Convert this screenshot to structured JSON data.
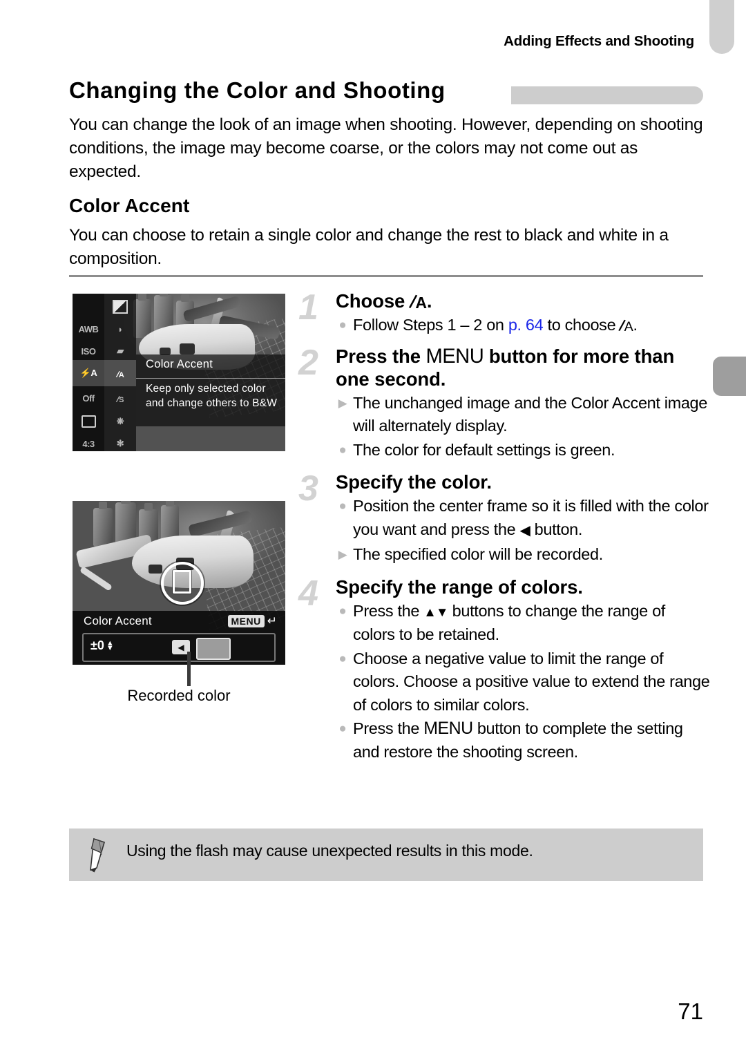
{
  "header": {
    "running_title": "Adding Effects and Shooting"
  },
  "section": {
    "title": "Changing the Color and Shooting",
    "intro": "You can change the look of an image when shooting. However, depending on shooting conditions, the image may become coarse, or the colors may not come out as expected."
  },
  "subsection": {
    "heading": "Color Accent",
    "body": "You can choose to retain a single color and change the rest to black and white in a composition."
  },
  "figures": {
    "fig1": {
      "menu_column_left": [
        "AWB",
        "ISO AUTO",
        "flash-auto",
        "Off",
        "frame",
        "4:3"
      ],
      "menu_column_right": [
        "half-tone",
        "fisheye",
        "miniature",
        "color-accent",
        "color-swap",
        "super-vivid",
        "poster"
      ],
      "selected_item": "color-accent",
      "desc_title": "Color Accent",
      "desc_body": "Keep only selected color and change others to B&W"
    },
    "fig2": {
      "bar_label": "Color Accent",
      "menu_chip": "MENU",
      "return_glyph": "↵",
      "value": "±0",
      "callout": "Recorded color"
    }
  },
  "steps": [
    {
      "num": "1",
      "head_pre": "Choose ",
      "head_post": ".",
      "bullets": [
        {
          "mark": "dot",
          "parts": [
            {
              "t": "text",
              "v": "Follow Steps 1 – 2 on "
            },
            {
              "t": "link",
              "v": "p. 64"
            },
            {
              "t": "text",
              "v": " to choose "
            },
            {
              "t": "accent",
              "v": ""
            },
            {
              "t": "text",
              "v": "."
            }
          ]
        }
      ]
    },
    {
      "num": "2",
      "head_pre": "Press the ",
      "head_menu": "MENU",
      "head_post": " button for more than one second.",
      "bullets": [
        {
          "mark": "tri",
          "parts": [
            {
              "t": "text",
              "v": "The unchanged image and the Color Accent image will alternately display."
            }
          ]
        },
        {
          "mark": "dot",
          "parts": [
            {
              "t": "text",
              "v": "The color for default settings is green."
            }
          ]
        }
      ]
    },
    {
      "num": "3",
      "head_pre": "Specify the color.",
      "head_post": "",
      "bullets": [
        {
          "mark": "dot",
          "parts": [
            {
              "t": "text",
              "v": "Position the center frame so it is filled with the color you want and press the "
            },
            {
              "t": "arrowleft",
              "v": "◀"
            },
            {
              "t": "text",
              "v": " button."
            }
          ]
        },
        {
          "mark": "tri",
          "parts": [
            {
              "t": "text",
              "v": "The specified color will be recorded."
            }
          ]
        }
      ]
    },
    {
      "num": "4",
      "head_pre": "Specify the range of colors.",
      "head_post": "",
      "bullets": [
        {
          "mark": "dot",
          "parts": [
            {
              "t": "text",
              "v": "Press the "
            },
            {
              "t": "arrowud",
              "v": "▲▼"
            },
            {
              "t": "text",
              "v": " buttons to change the range of colors to be retained."
            }
          ]
        },
        {
          "mark": "dot",
          "parts": [
            {
              "t": "text",
              "v": "Choose a negative value to limit the range of colors. Choose a positive value to extend the range of colors to similar colors."
            }
          ]
        },
        {
          "mark": "dot",
          "parts": [
            {
              "t": "text",
              "v": "Press the "
            },
            {
              "t": "menu",
              "v": "MENU"
            },
            {
              "t": "text",
              "v": " button to complete the setting and restore the shooting screen."
            }
          ]
        }
      ]
    }
  ],
  "note": {
    "icon": "pencil-icon",
    "text": "Using the flash may cause unexpected results in this mode."
  },
  "footer": {
    "page_number": "71"
  },
  "colors": {
    "link": "#1a26e8",
    "rule": "#8d8d8d",
    "tab_light": "#cdcdcd",
    "tab_dark": "#9e9e9e",
    "note_bg": "#cdcdcd",
    "step_num": "#d2d2d2"
  }
}
